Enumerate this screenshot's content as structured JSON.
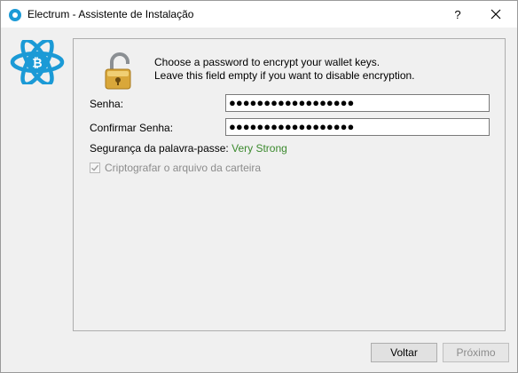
{
  "window": {
    "app_name": "Electrum",
    "separator": " - ",
    "title": "Assistente de Instalação",
    "help_label": "?"
  },
  "panel": {
    "message_line1": "Choose a password to encrypt your wallet keys.",
    "message_line2": "Leave this field empty if you want to disable encryption.",
    "password_label": "Senha:",
    "password_value": "●●●●●●●●●●●●●●●●●●",
    "confirm_label": "Confirmar Senha:",
    "confirm_value": "●●●●●●●●●●●●●●●●●●",
    "strength_label": "Segurança da palavra-passe:",
    "strength_value": "Very Strong",
    "encrypt_checkbox_label": "Criptografar o arquivo da carteira",
    "encrypt_checked": true
  },
  "buttons": {
    "back_label": "Voltar",
    "next_label": "Próximo"
  },
  "colors": {
    "strength": "#3c8a2e",
    "logo": "#1b9ad6"
  },
  "icons": {
    "app": "electrum-icon",
    "logo": "electrum-logo",
    "lock": "padlock-icon",
    "close": "close-icon"
  }
}
